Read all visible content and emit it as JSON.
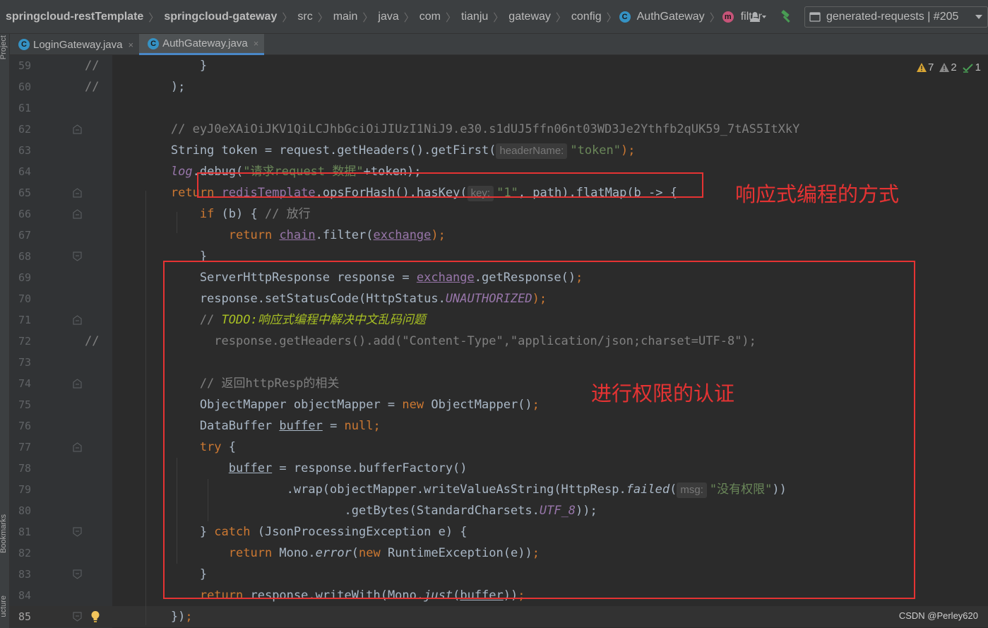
{
  "breadcrumbs": [
    {
      "label": "springcloud-restTemplate",
      "bold": true
    },
    {
      "label": "springcloud-gateway",
      "bold": true
    },
    {
      "label": "src"
    },
    {
      "label": "main"
    },
    {
      "label": "java"
    },
    {
      "label": "com"
    },
    {
      "label": "tianju"
    },
    {
      "label": "gateway"
    },
    {
      "label": "config"
    },
    {
      "label": "AuthGateway",
      "icon": "class-icon",
      "icon_char": "C"
    },
    {
      "label": "filter",
      "icon": "method-icon",
      "icon_char": "m"
    }
  ],
  "toolbar": {
    "run_config": "generated-requests | #205"
  },
  "tabs": [
    {
      "label": "LoginGateway.java",
      "icon_char": "C",
      "close": "×",
      "active": false
    },
    {
      "label": "AuthGateway.java",
      "icon_char": "C",
      "close": "×",
      "active": true
    }
  ],
  "side_tools": {
    "project": "Project",
    "bookmarks": "Bookmarks",
    "structure": "ucture"
  },
  "inspections": {
    "warnings": "7",
    "weak_warnings": "2",
    "ok": "1"
  },
  "lines": [
    {
      "n": "59",
      "gcom": "//",
      "tokens": [
        [
          "            }",
          ""
        ]
      ]
    },
    {
      "n": "60",
      "gcom": "//",
      "tokens": [
        [
          "        );",
          ""
        ]
      ]
    },
    {
      "n": "61",
      "tokens": []
    },
    {
      "n": "62",
      "tokens": [
        [
          "        // eyJ0eXAiOiJKV1QiLCJhbGciOiJIUzI1NiJ9.e30.s1dUJ5ffn06nt03WD3Je2Ythfb2qUK59_7tAS5ItXkY",
          "cm"
        ]
      ]
    },
    {
      "n": "63",
      "tokens": [
        [
          "        String token = request.getHeaders().getFirst(",
          ""
        ],
        [
          "headerName:",
          "hint"
        ],
        [
          "\"token\"",
          "str"
        ],
        [
          ");",
          "kw"
        ]
      ]
    },
    {
      "n": "64",
      "tokens": [
        [
          "        ",
          ""
        ],
        [
          "log",
          "fieldi"
        ],
        [
          ".debug(",
          ""
        ],
        [
          "\"请求request 数据\"",
          "str"
        ],
        [
          "+token);",
          ""
        ]
      ]
    },
    {
      "n": "65",
      "tokens": [
        [
          "        ",
          ""
        ],
        [
          "return",
          "kw"
        ],
        [
          " ",
          ""
        ],
        [
          "redisTemplate",
          "field"
        ],
        [
          ".opsForHash().hasKey(",
          ""
        ],
        [
          "key:",
          "hint"
        ],
        [
          "\"1\"",
          "str"
        ],
        [
          ", path).flatMap(b -> {",
          ""
        ]
      ]
    },
    {
      "n": "66",
      "tokens": [
        [
          "            ",
          ""
        ],
        [
          "if",
          "kw"
        ],
        [
          " (b) { ",
          ""
        ],
        [
          "// 放行",
          "cm"
        ]
      ]
    },
    {
      "n": "67",
      "tokens": [
        [
          "                ",
          ""
        ],
        [
          "return",
          "kw"
        ],
        [
          " ",
          ""
        ],
        [
          "chain",
          "field ul"
        ],
        [
          ".filter(",
          ""
        ],
        [
          "exchange",
          "field ul"
        ],
        [
          ");",
          "kw"
        ]
      ]
    },
    {
      "n": "68",
      "tokens": [
        [
          "            }",
          ""
        ]
      ]
    },
    {
      "n": "69",
      "tokens": [
        [
          "            ServerHttpResponse response = ",
          ""
        ],
        [
          "exchange",
          "field ul"
        ],
        [
          ".getResponse()",
          ""
        ],
        [
          ";",
          "kw"
        ]
      ]
    },
    {
      "n": "70",
      "tokens": [
        [
          "            response.setStatusCode(HttpStatus.",
          ""
        ],
        [
          "UNAUTHORIZED",
          "fieldi"
        ],
        [
          ");",
          "kw"
        ]
      ]
    },
    {
      "n": "71",
      "tokens": [
        [
          "            // ",
          "cm"
        ],
        [
          "TODO:",
          "todo"
        ],
        [
          "响应式编程中解决中文乱码问题",
          "todo"
        ]
      ]
    },
    {
      "n": "72",
      "gcom": "//",
      "tokens": [
        [
          "              response.getHeaders().add(\"Content-Type\",\"application/json;charset=UTF-8\");",
          "cm"
        ]
      ]
    },
    {
      "n": "73",
      "tokens": []
    },
    {
      "n": "74",
      "tokens": [
        [
          "            // 返回httpResp的相关",
          "cm"
        ]
      ]
    },
    {
      "n": "75",
      "tokens": [
        [
          "            ObjectMapper objectMapper = ",
          ""
        ],
        [
          "new",
          "kw"
        ],
        [
          " ObjectMapper()",
          ""
        ],
        [
          ";",
          "kw"
        ]
      ]
    },
    {
      "n": "76",
      "tokens": [
        [
          "            DataBuffer ",
          ""
        ],
        [
          "buffer",
          "ul"
        ],
        [
          " = ",
          ""
        ],
        [
          "null",
          "kw"
        ],
        [
          ";",
          "kw"
        ]
      ]
    },
    {
      "n": "77",
      "tokens": [
        [
          "            ",
          ""
        ],
        [
          "try",
          "kw"
        ],
        [
          " {",
          ""
        ]
      ]
    },
    {
      "n": "78",
      "tokens": [
        [
          "                ",
          ""
        ],
        [
          "buffer",
          "ul"
        ],
        [
          " = response.bufferFactory()",
          ""
        ]
      ]
    },
    {
      "n": "79",
      "tokens": [
        [
          "                        .wrap(objectMapper.writeValueAsString(HttpResp.",
          ""
        ],
        [
          "failed",
          "ital"
        ],
        [
          "(",
          ""
        ],
        [
          "msg:",
          "hint"
        ],
        [
          "\"没有权限\"",
          "str"
        ],
        [
          "))",
          ""
        ]
      ]
    },
    {
      "n": "80",
      "tokens": [
        [
          "                                .getBytes(StandardCharsets.",
          ""
        ],
        [
          "UTF_8",
          "fieldi"
        ],
        [
          "));",
          ""
        ]
      ]
    },
    {
      "n": "81",
      "tokens": [
        [
          "            } ",
          ""
        ],
        [
          "catch",
          "kw"
        ],
        [
          " (JsonProcessingException e) {",
          ""
        ]
      ]
    },
    {
      "n": "82",
      "tokens": [
        [
          "                ",
          ""
        ],
        [
          "return",
          "kw"
        ],
        [
          " Mono.",
          ""
        ],
        [
          "error",
          "ital"
        ],
        [
          "(",
          ""
        ],
        [
          "new",
          "kw"
        ],
        [
          " RuntimeException(e))",
          ""
        ],
        [
          ";",
          "kw"
        ]
      ]
    },
    {
      "n": "83",
      "tokens": [
        [
          "            }",
          ""
        ]
      ]
    },
    {
      "n": "84",
      "tokens": [
        [
          "            ",
          ""
        ],
        [
          "return",
          "kw"
        ],
        [
          " response.writeWith(Mono.",
          ""
        ],
        [
          "just",
          "ital"
        ],
        [
          "(",
          ""
        ],
        [
          "buffer",
          "ul"
        ],
        [
          "))",
          ""
        ],
        [
          ";",
          "kw"
        ]
      ]
    },
    {
      "n": "85",
      "current": true,
      "tokens": [
        [
          "        })",
          ""
        ],
        [
          ";",
          "kw"
        ]
      ]
    }
  ],
  "annotations": {
    "reactive": "响应式编程的方式",
    "auth": "进行权限的认证"
  },
  "watermark": "CSDN @Perley620",
  "colors": {
    "annotation_red": "#e53333",
    "keyword": "#cc7832",
    "string": "#6a8759",
    "comment": "#808080",
    "field": "#9876aa",
    "todo": "#a8c023",
    "tab_active_underline": "#4a88c7"
  }
}
